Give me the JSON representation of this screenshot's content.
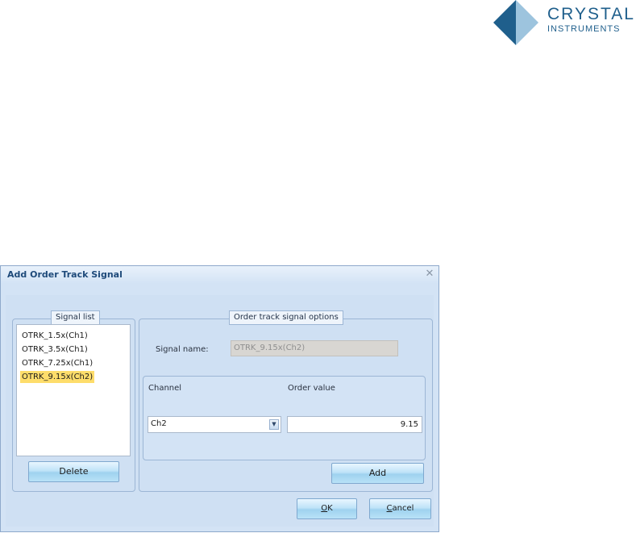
{
  "brand": {
    "name_line1": "CRYSTAL",
    "name_line2": "INSTRUMENTS",
    "colors": {
      "dark": "#1f5f8c",
      "light": "#9dc4de"
    }
  },
  "dialog": {
    "title": "Add Order Track Signal",
    "close_icon": "close-icon",
    "signal_list": {
      "legend": "Signal list",
      "items": [
        "OTRK_1.5x(Ch1)",
        "OTRK_3.5x(Ch1)",
        "OTRK_7.25x(Ch1)",
        "OTRK_9.15x(Ch2)"
      ],
      "selected_index": 3,
      "delete_label": "Delete"
    },
    "options": {
      "legend": "Order track signal options",
      "signal_name_label": "Signal name:",
      "signal_name_value": "OTRK_9.15x(Ch2)",
      "channel_label": "Channel",
      "channel_value": "Ch2",
      "order_value_label": "Order value",
      "order_value": "9.15",
      "add_label": "Add"
    },
    "ok_mnemonic": "O",
    "ok_rest": "K",
    "cancel_mnemonic": "C",
    "cancel_rest": "ancel"
  }
}
